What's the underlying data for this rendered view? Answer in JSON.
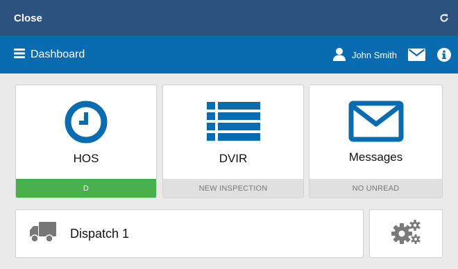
{
  "topbar": {
    "close_label": "Close",
    "refresh_icon": "refresh-icon"
  },
  "navbar": {
    "menu_icon": "hamburger-icon",
    "title": "Dashboard",
    "user_name": "John Smith",
    "user_icon": "user-icon",
    "mail_icon": "envelope-icon",
    "info_icon": "info-icon"
  },
  "tiles": [
    {
      "title": "HOS",
      "status": "D",
      "icon": "clock-icon",
      "status_color": "#48b04a"
    },
    {
      "title": "DVIR",
      "status": "NEW INSPECTION",
      "icon": "list-icon"
    },
    {
      "title": "Messages",
      "status": "NO UNREAD",
      "icon": "envelope-icon"
    }
  ],
  "dispatch": {
    "label": "Dispatch 1",
    "icon": "truck-icon"
  },
  "settings": {
    "icon": "gears-icon"
  },
  "colors": {
    "topbar": "#2c5280",
    "navbar": "#0a6cb0",
    "accent": "#0a6cb0",
    "status_green": "#48b04a"
  }
}
